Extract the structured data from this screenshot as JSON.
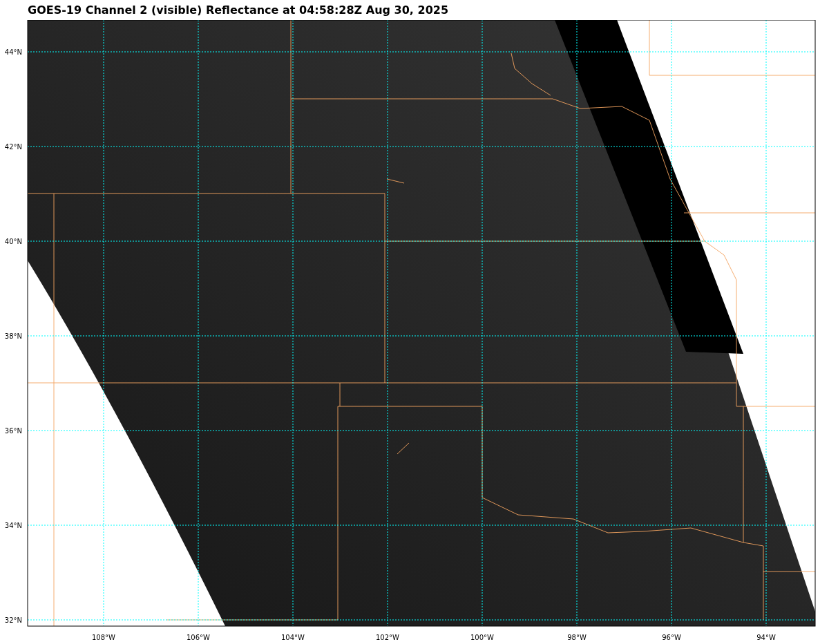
{
  "title": "GOES-19 Channel 2 (visible) Reflectance at 04:58:28Z Aug 30, 2025",
  "lat_labels": [
    "44°N",
    "42°N",
    "40°N",
    "38°N",
    "36°N",
    "34°N",
    "32°N"
  ],
  "lon_labels": [
    "108°W",
    "106°W",
    "104°W",
    "102°W",
    "100°W",
    "98°W",
    "96°W",
    "94°W"
  ]
}
